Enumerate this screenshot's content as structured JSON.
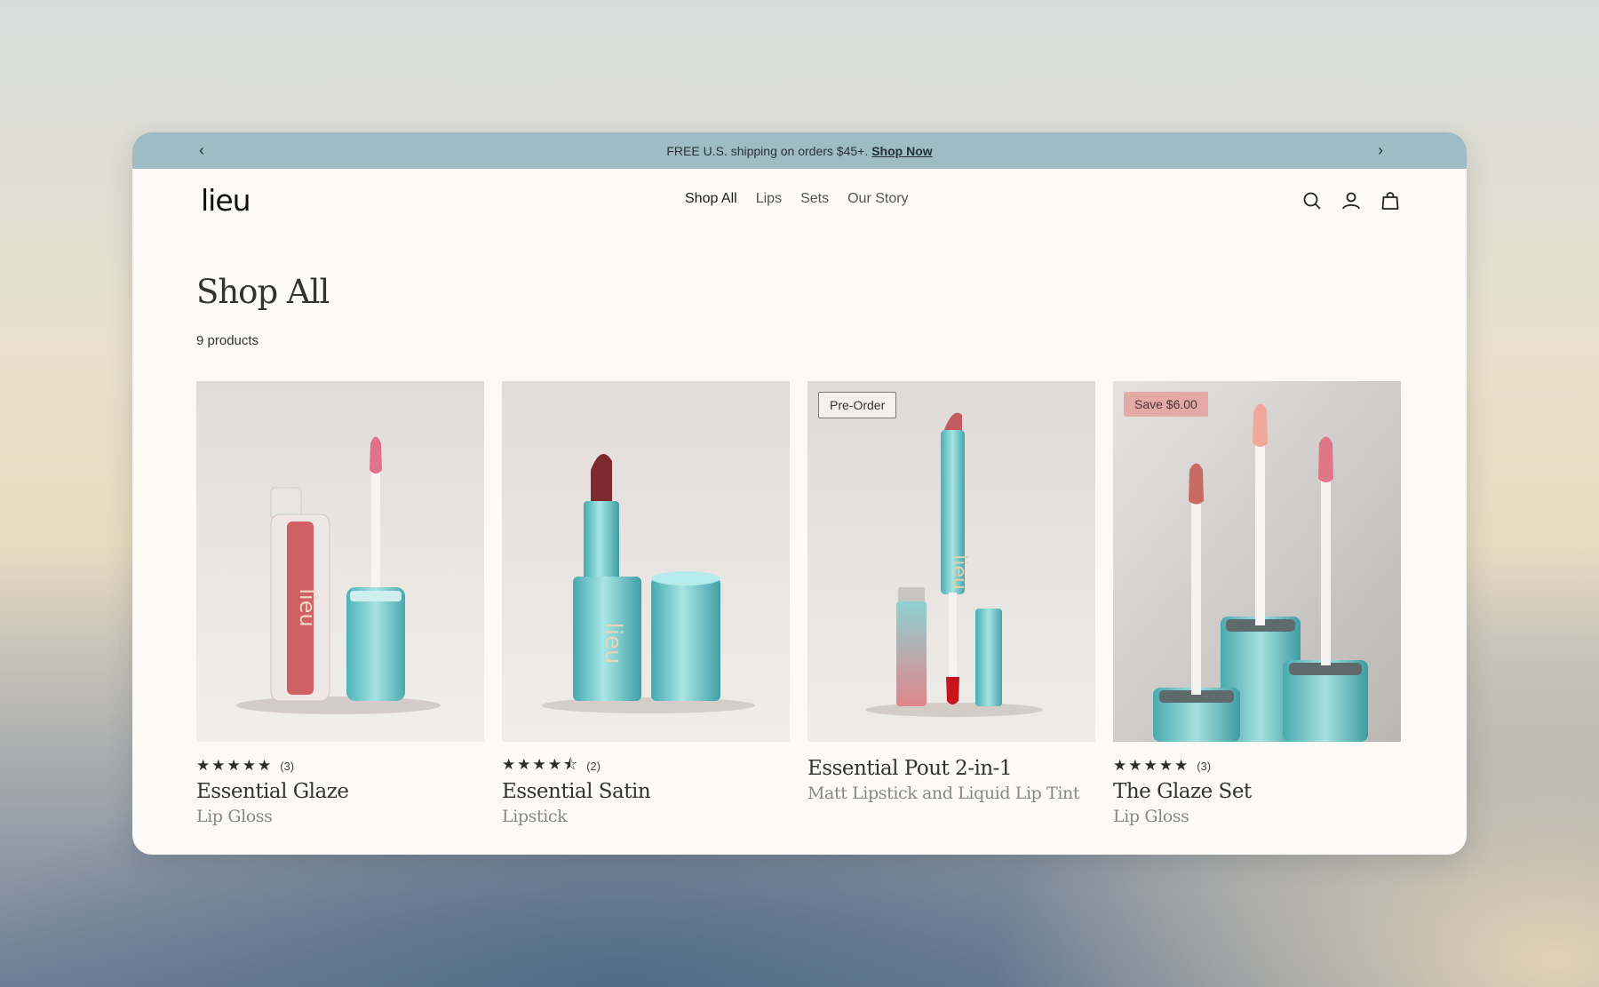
{
  "announcement": {
    "text": "FREE U.S. shipping on orders $45+.",
    "link": "Shop Now",
    "prev_icon": "chevron-left-icon",
    "next_icon": "chevron-right-icon"
  },
  "header": {
    "logo": "lieu",
    "nav": [
      "Shop All",
      "Lips",
      "Sets",
      "Our Story"
    ],
    "active_nav": "Shop All",
    "icons": [
      "search-icon",
      "account-icon",
      "bag-icon"
    ]
  },
  "page": {
    "title": "Shop All",
    "count": "9 products"
  },
  "products": [
    {
      "name": "Essential Glaze",
      "subtitle": "Lip Gloss",
      "stars": "★★★★★",
      "rating": 5,
      "reviews": "(3)",
      "badge": ""
    },
    {
      "name": "Essential Satin",
      "subtitle": "Lipstick",
      "stars": "★★★★⯪",
      "rating": 4.5,
      "reviews": "(2)",
      "badge": ""
    },
    {
      "name": "Essential Pout 2-in-1",
      "subtitle": "Matt Lipstick and Liquid Lip Tint",
      "stars": "",
      "rating": null,
      "reviews": "",
      "badge": "Pre-Order"
    },
    {
      "name": "The Glaze Set",
      "subtitle": "Lip Gloss",
      "stars": "★★★★★",
      "rating": 5,
      "reviews": "(3)",
      "badge": "Save $6.00"
    }
  ],
  "colors": {
    "announcement_bg": "#9dbcc3",
    "page_bg": "#fbfaf7",
    "packaging_teal": "#7fcfd2",
    "sale_badge": "#e3aaa6"
  }
}
